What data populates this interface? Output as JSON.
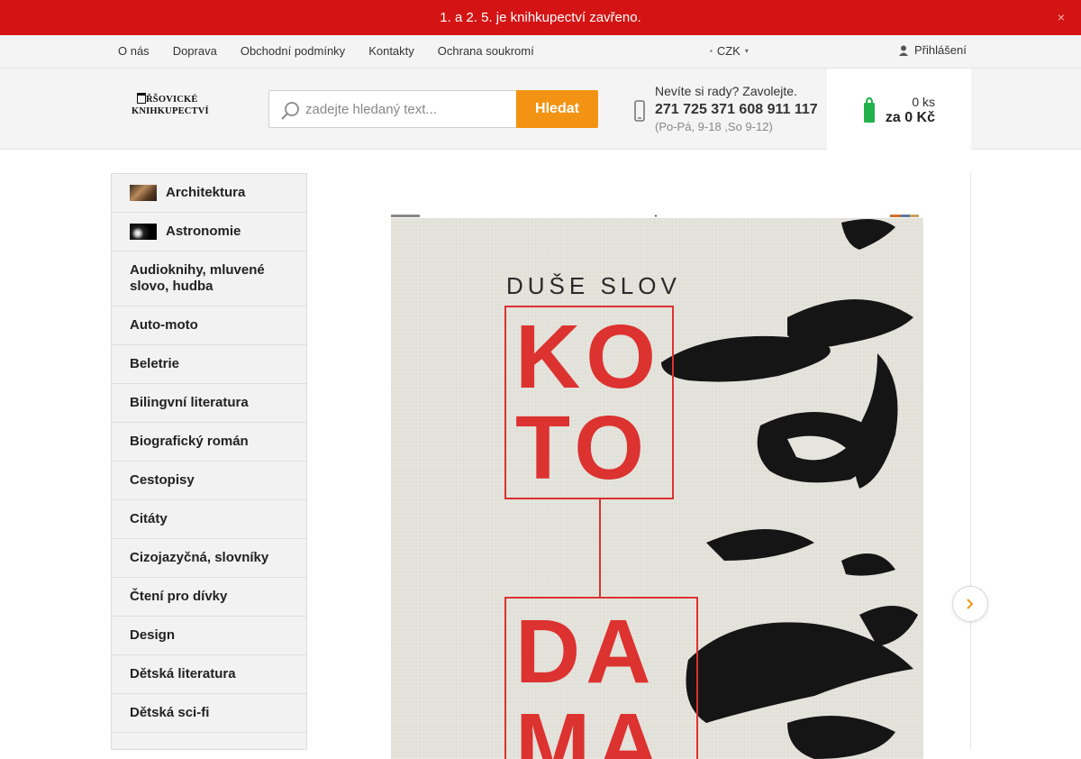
{
  "announcement": {
    "text": "1. a 2. 5. je knihkupectví zavřeno.",
    "close_glyph": "×"
  },
  "topnav": {
    "links": [
      "O nás",
      "Doprava",
      "Obchodní podmínky",
      "Kontakty",
      "Ochrana soukromí"
    ],
    "currency": "CZK",
    "login": "Přihlášení"
  },
  "header": {
    "logo": {
      "line1": "ŘŠOVICKÉ",
      "line2": "KNIHKUPECTVÍ"
    },
    "search": {
      "placeholder": "zadejte hledaný text...",
      "button": "Hledat"
    },
    "contact": {
      "question": "Nevíte si rady? Zavolejte.",
      "phone": "271 725 371 608 911 117",
      "hours": "(Po-Pá, 9-18 ,So 9-12)"
    },
    "cart": {
      "quantity": "0 ks",
      "total": "za 0 Kč"
    }
  },
  "categories": [
    {
      "label": "Architektura",
      "thumb": "arch"
    },
    {
      "label": "Astronomie",
      "thumb": "astro"
    },
    {
      "label": "Audioknihy, mluvené slovo, hudba"
    },
    {
      "label": "Auto-moto"
    },
    {
      "label": "Beletrie"
    },
    {
      "label": "Bilingvní literatura"
    },
    {
      "label": "Biografický román"
    },
    {
      "label": "Cestopisy"
    },
    {
      "label": "Citáty"
    },
    {
      "label": "Cizojazyčná, slovníky"
    },
    {
      "label": "Čtení pro dívky"
    },
    {
      "label": "Design"
    },
    {
      "label": "Dětská literatura"
    },
    {
      "label": "Dětská sci-fi"
    }
  ],
  "cover": {
    "subtitle": "DUŠE SLOV",
    "letters": [
      "KO",
      "TO",
      "DA",
      "MA"
    ]
  },
  "colors": {
    "announcement_bg": "#d41414",
    "accent_orange": "#f39313",
    "cart_green": "#22b14c",
    "cover_red": "#dc3230"
  },
  "icons": {
    "close": "close-icon",
    "currency": "currency-icon",
    "login": "user-icon",
    "search": "magnifier-icon",
    "phone": "phone-icon",
    "cart": "shopping-bag-icon",
    "next": "chevron-right-icon"
  }
}
